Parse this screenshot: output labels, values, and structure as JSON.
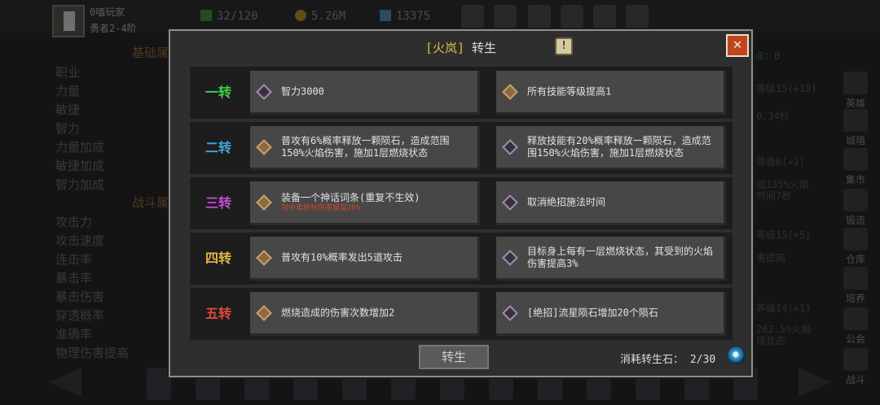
{
  "player": {
    "name": "0嗑玩家",
    "rank": "勇者2-4阶"
  },
  "top_stats": {
    "stamina": "32/120",
    "gold": "5.26M",
    "gems": "13375"
  },
  "background": {
    "section_basic": "基础属",
    "section_battle": "战斗属",
    "basic_stats": [
      "职业",
      "力量",
      "敏捷",
      "智力",
      "力量加成",
      "敏捷加成",
      "智力加成"
    ],
    "battle_stats": [
      "攻击力",
      "攻击速度",
      "连击率",
      "暴击率",
      "暴击伤害",
      "穿透概率",
      "准确率",
      "物理伤害提高"
    ],
    "right_points": "点：0",
    "right_texts": [
      "等级15(+10)",
      "0.34秒",
      "等级6(+1)",
      "成135%火焰",
      "时间7秒",
      "等级15(+5)",
      "害提高",
      "等级14(+1)",
      "262.5%火焰",
      "烧状态"
    ],
    "side_menu": [
      "英雄",
      "城墙",
      "集市",
      "锻造",
      "仓库",
      "培养",
      "公会",
      "战斗"
    ]
  },
  "dialog": {
    "hero_name": "[火岚]",
    "title": "转生",
    "info_symbol": "!",
    "close_symbol": "✕",
    "rows": [
      {
        "rank_label": "一转",
        "rank_color": "#3fd24a",
        "left": {
          "text": "智力3000",
          "sub": ""
        },
        "right": {
          "text": "所有技能等级提高1"
        }
      },
      {
        "rank_label": "二转",
        "rank_color": "#3fa7e0",
        "left": {
          "text": "普攻有6%概率释放一颗陨石，造成范围150%火焰伤害，施加1层燃烧状态",
          "sub": ""
        },
        "right": {
          "text": "释放技能有20%概率释放一颗陨石，造成范围150%火焰伤害，施加1层燃烧状态"
        }
      },
      {
        "rank_label": "三转",
        "rank_color": "#c94ad8",
        "left": {
          "text": "装备一个神话词条(重复不生效)",
          "sub": "对中毒目标伤害提高20%"
        },
        "right": {
          "text": "取消绝招施法时间"
        }
      },
      {
        "rank_label": "四转",
        "rank_color": "#e6b64a",
        "left": {
          "text": "普攻有10%概率发出5道攻击",
          "sub": ""
        },
        "right": {
          "text": "目标身上每有一层燃烧状态，其受到的火焰伤害提高3%"
        }
      },
      {
        "rank_label": "五转",
        "rank_color": "#e04a36",
        "left": {
          "text": "燃烧造成的伤害次数增加2",
          "sub": ""
        },
        "right": {
          "text": "[绝招]流星陨石增加20个陨石"
        }
      }
    ],
    "rebirth_button": "转生",
    "cost_label": "消耗转生石：",
    "cost_value": "2/30"
  }
}
